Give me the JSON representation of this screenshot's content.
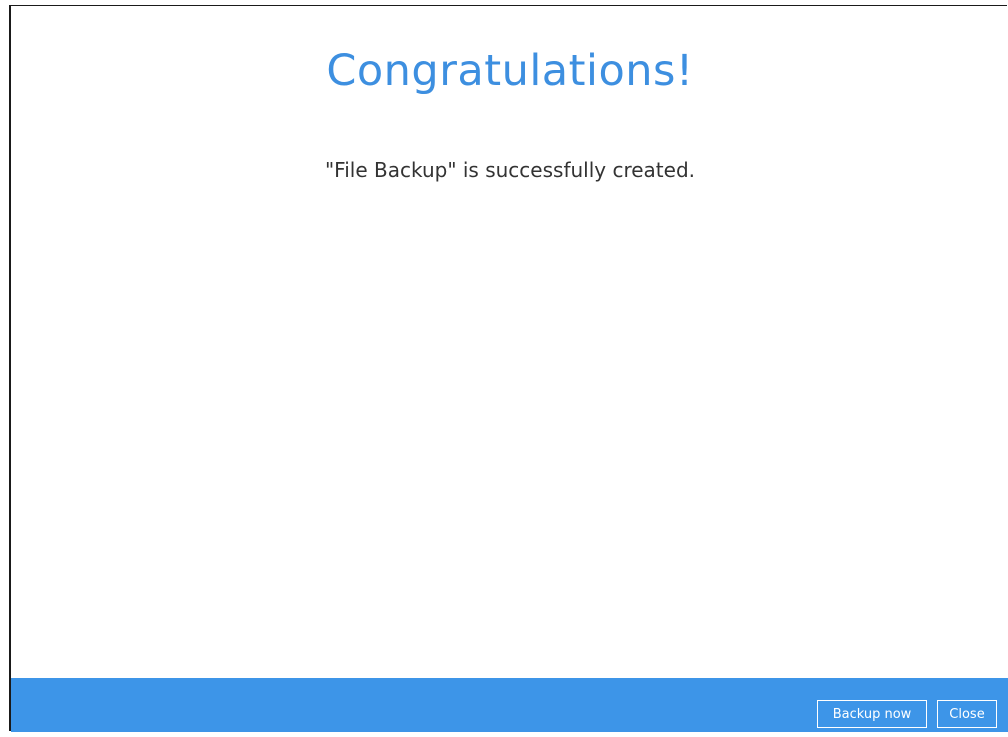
{
  "dialog": {
    "title": "Congratulations!",
    "message": "\"File Backup\" is successfully created."
  },
  "footer": {
    "backup_now_label": "Backup now",
    "close_label": "Close"
  },
  "colors": {
    "title": "#3d8fe0",
    "footer": "#3d95e8",
    "button_border": "#ffffff"
  }
}
